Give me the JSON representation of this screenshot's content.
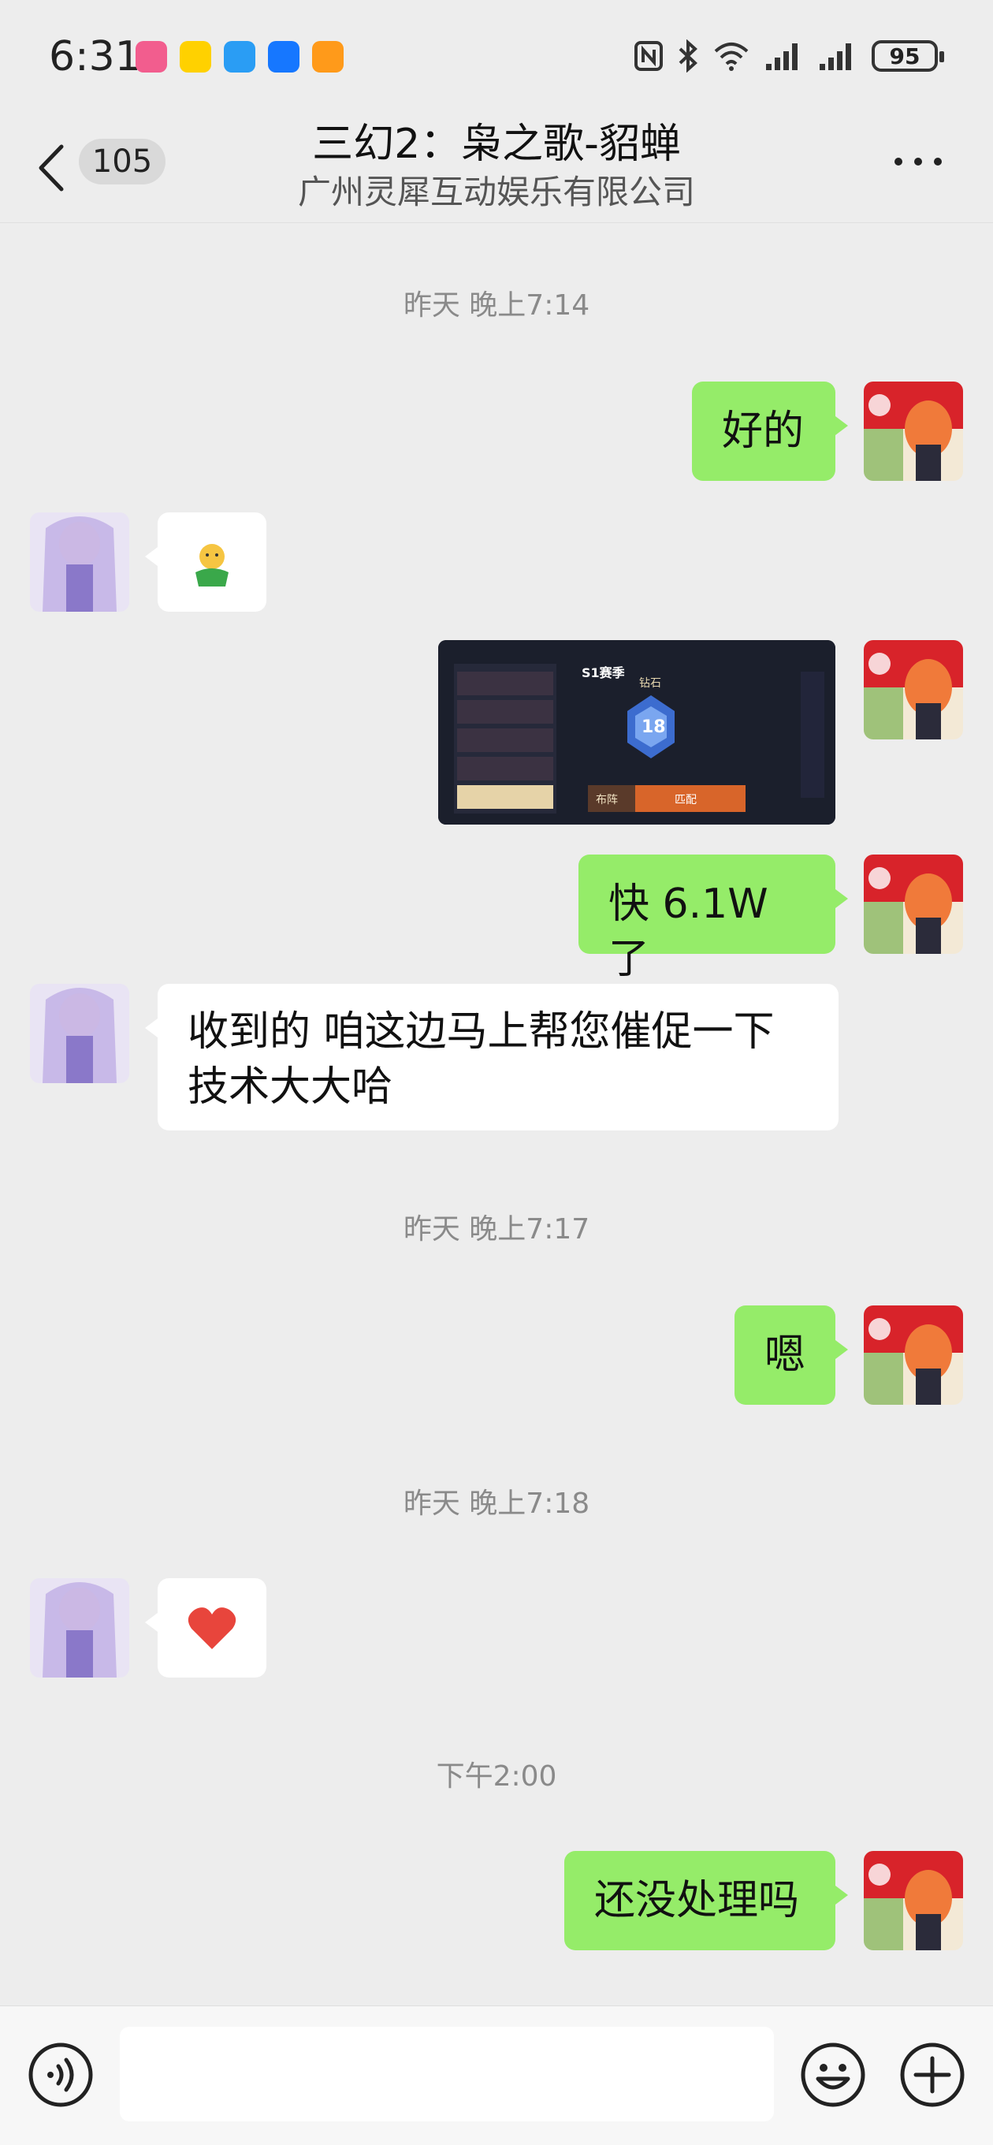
{
  "status_bar": {
    "time": "6:31",
    "battery": "95",
    "icons": [
      "bilibili-app-icon",
      "meituan-app-icon",
      "messages-app-icon",
      "pay-app-icon",
      "taobao-app-icon",
      "nfc-icon",
      "bluetooth-icon",
      "wifi-icon",
      "signal-icon",
      "signal-icon-2",
      "battery-icon"
    ]
  },
  "header": {
    "unread_count": "105",
    "title": "三幻2：枭之歌-貂蝉",
    "subtitle": "广州灵犀互动娱乐有限公司"
  },
  "messages": [
    {
      "type": "timestamp",
      "text": "昨天 晚上7:14"
    },
    {
      "type": "text",
      "from": "me",
      "text": "好的"
    },
    {
      "type": "emoji",
      "from": "them",
      "icon": "person-shrug-emoji"
    },
    {
      "type": "image",
      "from": "me",
      "caption": "S1赛季",
      "rank": "钻石",
      "level": "18",
      "buttons": [
        "布阵",
        "匹配"
      ]
    },
    {
      "type": "text",
      "from": "me",
      "text": "快 6.1W 了"
    },
    {
      "type": "text",
      "from": "them",
      "lines": [
        "收到的 咱这边马上帮您催促一下",
        "技术大大哈"
      ]
    },
    {
      "type": "timestamp",
      "text": "昨天 晚上7:17"
    },
    {
      "type": "text",
      "from": "me",
      "text": "嗯"
    },
    {
      "type": "timestamp",
      "text": "昨天 晚上7:18"
    },
    {
      "type": "emoji",
      "from": "them",
      "icon": "heart-emoji"
    },
    {
      "type": "timestamp",
      "text": "下午2:00"
    },
    {
      "type": "text",
      "from": "me",
      "text": "还没处理吗"
    }
  ],
  "input_bar": {
    "voice_icon": "voice-icon",
    "emoji_icon": "smiley-icon",
    "add_icon": "plus-icon",
    "input_value": ""
  },
  "colors": {
    "background": "#ededed",
    "my_bubble": "#95ec69",
    "their_bubble": "#ffffff",
    "heart": "#e8453c"
  }
}
